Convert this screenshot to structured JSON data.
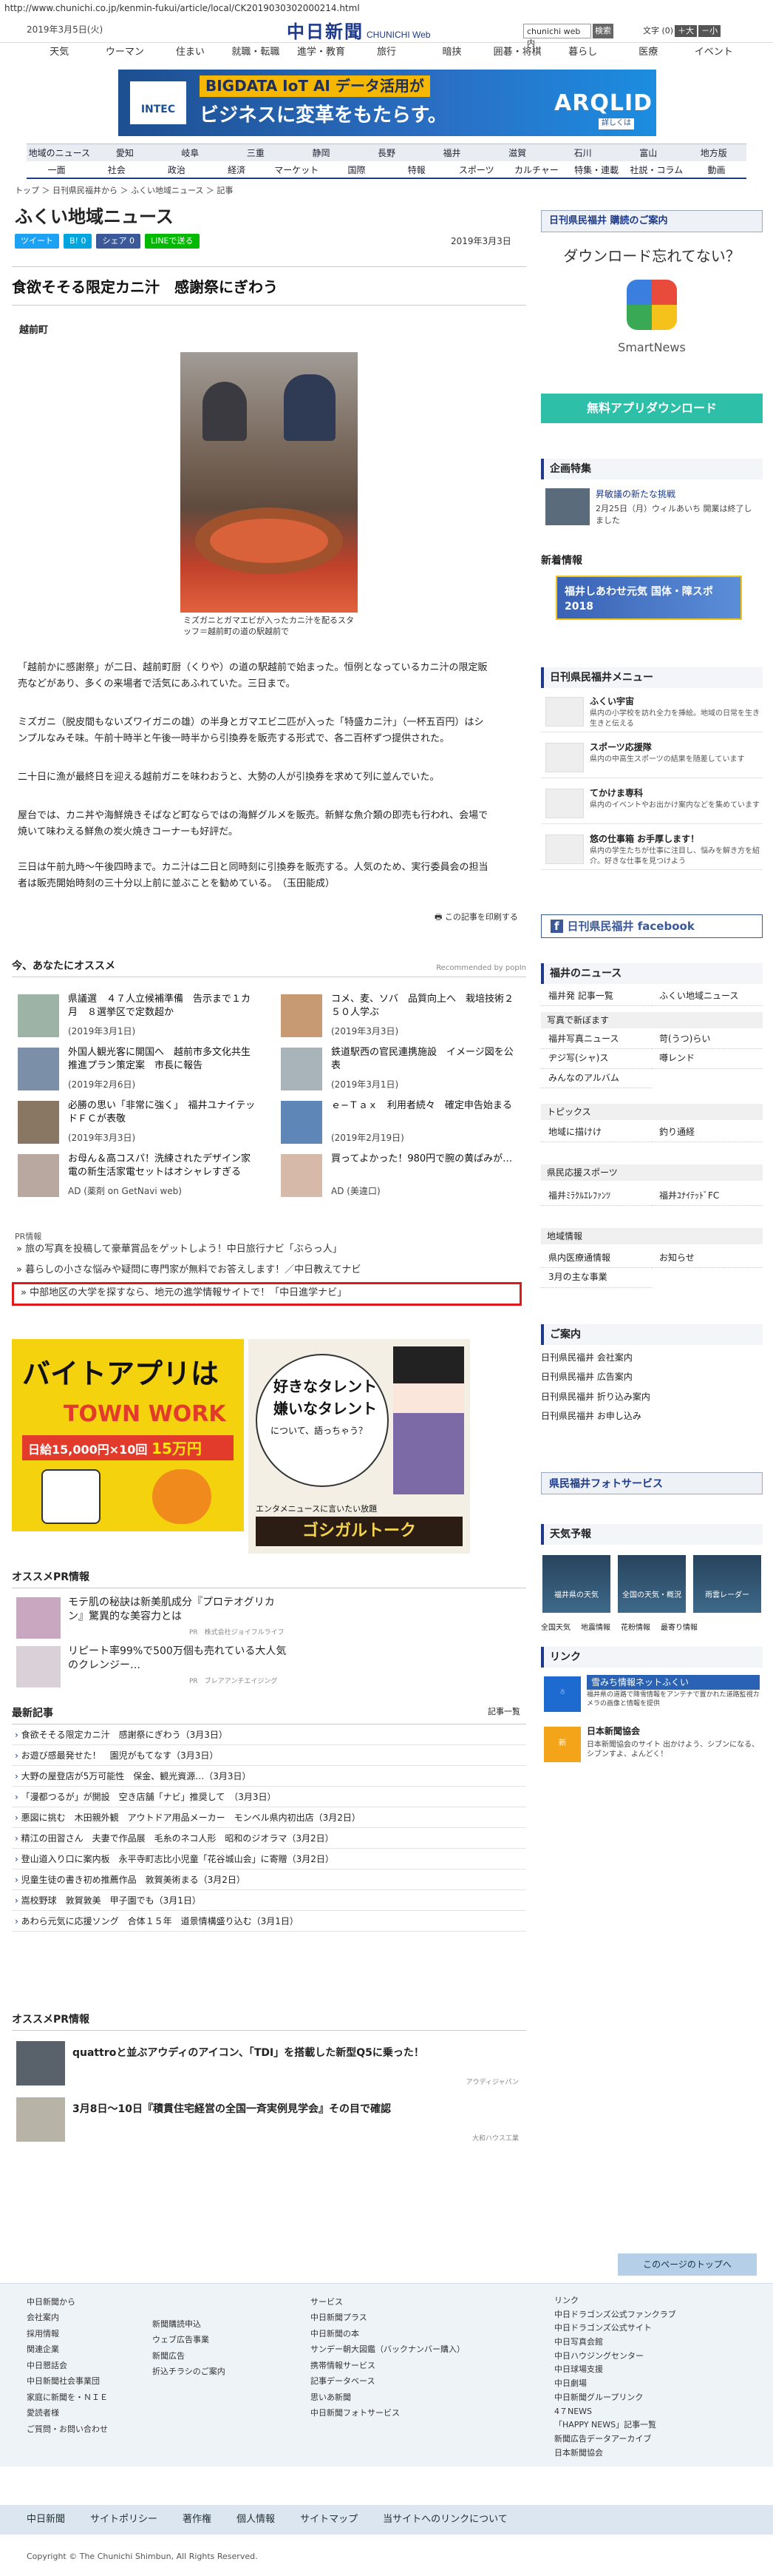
{
  "url": "http://www.chunichi.co.jp/kenmin-fukui/article/local/CK2019030302000214.html",
  "header": {
    "date": "2019年3月5日(火)",
    "logo": "中日新聞",
    "logo_sub": "CHUNICHI Web",
    "search_placeholder": "chunichi web 内",
    "search_button": "検索",
    "font_label": "文字",
    "font_reset": "(0)",
    "font_plus": "＋大",
    "font_minus": "－小"
  },
  "global_nav": [
    "天気",
    "ウーマン",
    "住まい",
    "就職・転職",
    "進学・教育",
    "旅行",
    "暗挟",
    "囲碁・将棋",
    "暮らし",
    "医療",
    "イベント"
  ],
  "banner": {
    "brand": "INTEC",
    "keywords": "BIGDATA IoT AI データ活用が",
    "copy": "ビジネスに変革をもたらす。",
    "product": "ARQLID",
    "more": "詳しくは"
  },
  "regional_nav": [
    "地域のニュース",
    "愛知",
    "岐阜",
    "三重",
    "静岡",
    "長野",
    "福井",
    "滋賀",
    "石川",
    "富山",
    "地方版"
  ],
  "category_nav": [
    "一面",
    "社会",
    "政治",
    "経済",
    "マーケット",
    "国際",
    "特報",
    "スポーツ",
    "カルチャー",
    "特集・連載",
    "社説・コラム",
    "動画"
  ],
  "breadcrumb": "トップ ＞ 日刊県民福井から ＞ ふくい地域ニュース ＞ 記事",
  "section_title": "ふくい地域ニュース",
  "share": [
    "ツイート",
    "B! 0",
    "シェア 0",
    "LINEで送る"
  ],
  "article": {
    "date": "2019年3月3日",
    "headline": "食欲そそる限定カニ汁　感謝祭にぎわう",
    "place": "越前町",
    "caption": "ミズガニとガマエビが入ったカニ汁を配るスタッフ＝越前町の道の駅越前で",
    "paragraphs": [
      "「越前かに感謝祭」が二日、越前町厨（くりや）の道の駅越前で始まった。恒例となっているカニ汁の限定販売などがあり、多くの来場者で活気にあふれていた。三日まで。",
      "ミズガニ（脱皮間もないズワイガニの雄）の半身とガマエビ二匹が入った「特盛カニ汁」（一杯五百円）はシンプルなみそ味。午前十時半と午後一時半から引換券を販売する形式で、各二百杯ずつ提供された。",
      "二十日に漁が最終日を迎える越前ガニを味わおうと、大勢の人が引換券を求めて列に並んでいた。",
      "屋台では、カニ丼や海鮮焼きそばなど町ならではの海鮮グルメを販売。新鮮な魚介類の即売も行われ、会場で焼いて味わえる鮮魚の炭火焼きコーナーも好評だ。",
      "三日は午前九時～午後四時まで。カニ汁は二日と同時刻に引換券を販売する。人気のため、実行委員会の担当者は販売開始時刻の三十分以上前に並ぶことを勧めている。　（玉田能成）"
    ],
    "print": "この記事を印刷する"
  },
  "recommend": {
    "title": "今、あなたにオススメ",
    "provider": "Recommended by popIn",
    "items": [
      {
        "text": "県議選　４７人立候補準備　告示まで１カ月　８選挙区で定数超か",
        "date": "(2019年3月1日)"
      },
      {
        "text": "コメ、麦、ソバ　品質向上へ　栽培技術２５０人学ぶ",
        "date": "(2019年3月3日)"
      },
      {
        "text": "外国人観光客に開国へ　越前市多文化共生推進プラン策定案　市長に報告",
        "date": "(2019年2月6日)"
      },
      {
        "text": "鉄道駅西の官民連携施設　イメージ図を公表",
        "date": "(2019年3月1日)"
      },
      {
        "text": "必勝の思い「非常に強く」　福井ユナイテッドＦＣが表敬",
        "date": "(2019年3月3日)"
      },
      {
        "text": "ｅ−Ｔａｘ　利用者続々　確定申告始まる",
        "date": "(2019年2月19日)"
      },
      {
        "text": "お母ん＆高コスパ！洗練されたデザイン家電の新生活家電セットはオシャレすぎる",
        "date": "AD (薬剤 on GetNavi web)"
      },
      {
        "text": "買ってよかった！980円で腕の黄ばみが…",
        "date": "AD (美違口)"
      }
    ]
  },
  "pr_label": "PR情報",
  "pr_lines": [
    "旅の写真を投稿して豪華賞品をゲットしよう！中日旅行ナビ「ぶらっ人」",
    "暮らしの小さな悩みや疑問に専門家が無料でお答えします！／中日教えてナビ",
    "中部地区の大学を探すなら、地元の進学情報サイトで！「中日進学ナビ」"
  ],
  "ads": {
    "ad1_title": "バイトアプリは",
    "ad1_brand": "TOWN WORK",
    "ad1_prize": "日給15,000円×10回",
    "ad1_prize_total": "15万円",
    "ad2_line1": "好きなタレント",
    "ad2_line2": "嫌いなタレント",
    "ad2_line3": "について、語っちゃう？",
    "ad2_sub": "エンタメニュースに言いたい放題",
    "ad2_brand": "ゴシガルトーク"
  },
  "pr2": {
    "title": "オススメPR情報",
    "items": [
      {
        "text": "モテ肌の秘訣は新美肌成分『プロテオグリカン』驚異的な美容力とは",
        "src": "PR　株式会社ジョイフルライフ"
      },
      {
        "text": "リピート率99%で500万個も売れている大人気のクレンジー…",
        "src": "PR　ブレアアンチエイジング"
      }
    ]
  },
  "latest": {
    "title": "最新記事",
    "more": "記事一覧",
    "items": [
      "食欲そそる限定カニ汁　感謝祭にぎわう（3月3日）",
      "お遊び感最発せた！　園児がもてなす（3月3日）",
      "大野の屋登店が5万可能性　保金、観光資源…（3月3日）",
      "「漫都つるが」が開設　空き店舗「ナビ」推奨して　（3月3日）",
      "悪図に挑む　木田親外観　アウトドア用品メーカー　モンベル県内初出店（3月2日）",
      "精江の田習さん　夫妻で作品展　毛糸のネコ人形　昭和のジオラマ（3月2日）",
      "登山道入り口に案内板　永平寺町志比小児童「花谷城山会」に寄贈（3月2日）",
      "児童生徒の書き初め推薦作品　敦賀美術まる（3月2日）",
      "嵩校野球　敦賀敦美　甲子園でも（3月1日）",
      "あわら元気に応援ソング　合体１５年　道景情構盛り込む（3月1日）"
    ]
  },
  "pr3": {
    "title": "オススメPR情報",
    "items": [
      {
        "text": "quattroと並ぶアウディのアイコン、「TDI」を搭載した新型Q5に乗った！",
        "src": "アウディジャパン"
      },
      {
        "text": "3月8日〜10日『積貫住宅経営の全国一斉実例見学会』その目で確認",
        "src": "大和ハウス工業"
      }
    ]
  },
  "sidebar": {
    "subscribe": "日刊県民福井 購読のご案内",
    "dl_title": "ダウンロード忘れてない？",
    "app_name": "SmartNews",
    "dl_button": "無料アプリダウンロード",
    "feature_title": "企画特集",
    "feature_item": "昇敏議の新たな挑戦",
    "feature_desc": "2月25日（月）ウィルあいち 開業は終了しました",
    "new_info": "新着情報",
    "kokutai": "福井しあわせ元気 国体・障スポ 2018",
    "menu_title": "日刊県民福井メニュー",
    "menu": [
      {
        "t1": "ふくい宇宙",
        "t2": "県内の小学校を訪れ全力を挿絵。地域の日常を生き生きと伝える"
      },
      {
        "t1": "スポーツ応援隊",
        "t2": "県内の中高生スポーツの結果を随差しています"
      },
      {
        "t1": "てかけま専科",
        "t2": "県内のイベントやお出かけ案内などを集めています"
      },
      {
        "t1": "悠の仕事箱 お手厚します！",
        "t2": "県内の学生たちが仕事に注目し、悩みを解き方を紹介。好きな仕事を見つけよう"
      }
    ],
    "facebook": "日刊県民福井 facebook",
    "news_title": "福井のニュース",
    "news_grid": [
      "福井発 記事一覧",
      "ふくい地域ニュース"
    ],
    "photo_title": "写真で新ぼます",
    "photo_grid": [
      "福井写真ニュース",
      "苛(うつ)らい",
      "ヂジ写(シャ)ス",
      "噂レンド",
      "みんなのアルバム"
    ],
    "topics_title": "トピックス",
    "topics_grid": [
      "地域に描けけ",
      "釣り通経"
    ],
    "sports_title": "県民応援スポーツ",
    "sports_grid": [
      "福井ﾐﾗｸﾙｴﾚﾌｧﾝﾂ",
      "福井ﾕﾅｲﾃｯﾄﾞFC"
    ],
    "local_title": "地域情報",
    "local_grid": [
      "県内医療通情報",
      "お知らせ",
      "3月の主な事業"
    ],
    "guide_title": "ご案内",
    "guide_list": [
      "日刊県民福井 会社案内",
      "日刊県民福井 広告案内",
      "日刊県民福井 折り込み案内",
      "日刊県民福井 お申し込み"
    ],
    "photo_service": "県民福井フォトサービス",
    "weather_title": "天気予報",
    "weather": [
      "福井県の天気",
      "全国の天気・概況",
      "雨雲レーダー"
    ],
    "weather_links": [
      "全国天気",
      "地震情報",
      "花粉情報",
      "最寄り情報"
    ],
    "link_title": "リンク",
    "link1": "雪みち情報ネットふくい",
    "link1_desc": "福井県の道路で降雪情報をアンテナで置かれた道路監視カメラの画像と情報を提供",
    "link2": "日本新聞協会",
    "link2_desc": "日本新聞協会のサイト 出かけよう、シブンになる、シブンすよ、よんどく！"
  },
  "page_top": "このページのトップへ",
  "footer": {
    "col1": [
      "中日新聞から",
      "会社案内",
      "採用情報",
      "関連企業",
      "中日懇話会",
      "中日新聞社会事業団",
      "家庭に新聞を・ＮＩＥ",
      "愛読者様",
      "ご質問・お問い合わせ"
    ],
    "col2": [
      "新聞購読申込",
      "ウェブ広告事業",
      "新聞広告",
      "折込チラシのご案内"
    ],
    "col3": [
      "サービス",
      "中日新聞プラス",
      "中日新聞の本",
      "サンデー朝大図鑑（バックナンバー購入）",
      "携帯情報サービス",
      "記事データベース",
      "思いあ新聞",
      "中日新聞フォトサービス"
    ],
    "col4": [
      "リンク",
      "中日ドラゴンズ公式ファンクラブ",
      "中日ドラゴンズ公式サイト",
      "中日写真会館",
      "中日ハウジングセンター",
      "中日球場支援",
      "中日劇場",
      "中日新聞グループリンク",
      "4７NEWS",
      "「HAPPY NEWS」記事一覧",
      "新聞広告データアーカイブ",
      "日本新聞協会"
    ],
    "bar": [
      "中日新聞",
      "サイトポリシー",
      "著作権",
      "個人情報",
      "サイトマップ",
      "当サイトへのリンクについて"
    ],
    "copyright": "Copyright © The Chunichi Shimbun, All Rights Reserved."
  },
  "colors": {
    "brand": "#1e3a8a",
    "highlight": "#e0191b",
    "download": "#2dbfa7",
    "facebook": "#3b5998"
  }
}
